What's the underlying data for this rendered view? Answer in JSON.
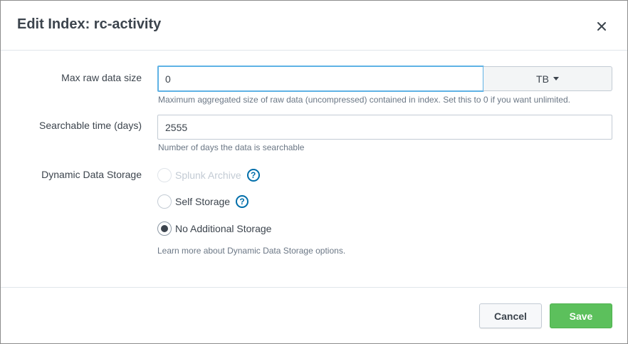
{
  "modal": {
    "title": "Edit Index: rc-activity"
  },
  "max_raw": {
    "label": "Max raw data size",
    "value": "0",
    "unit": "TB",
    "help": "Maximum aggregated size of raw data (uncompressed) contained in index. Set this to 0 if you want unlimited."
  },
  "searchable": {
    "label": "Searchable time (days)",
    "value": "2555",
    "help": "Number of days the data is searchable"
  },
  "storage": {
    "label": "Dynamic Data Storage",
    "options": [
      {
        "label": "Splunk Archive"
      },
      {
        "label": "Self Storage"
      },
      {
        "label": "No Additional Storage"
      }
    ],
    "learn_more": "Learn more about Dynamic Data Storage options."
  },
  "footer": {
    "cancel_label": "Cancel",
    "save_label": "Save"
  },
  "colors": {
    "save": "#5cc05c",
    "focus_border": "#5fb2e5",
    "help_icon": "#006eaa"
  }
}
